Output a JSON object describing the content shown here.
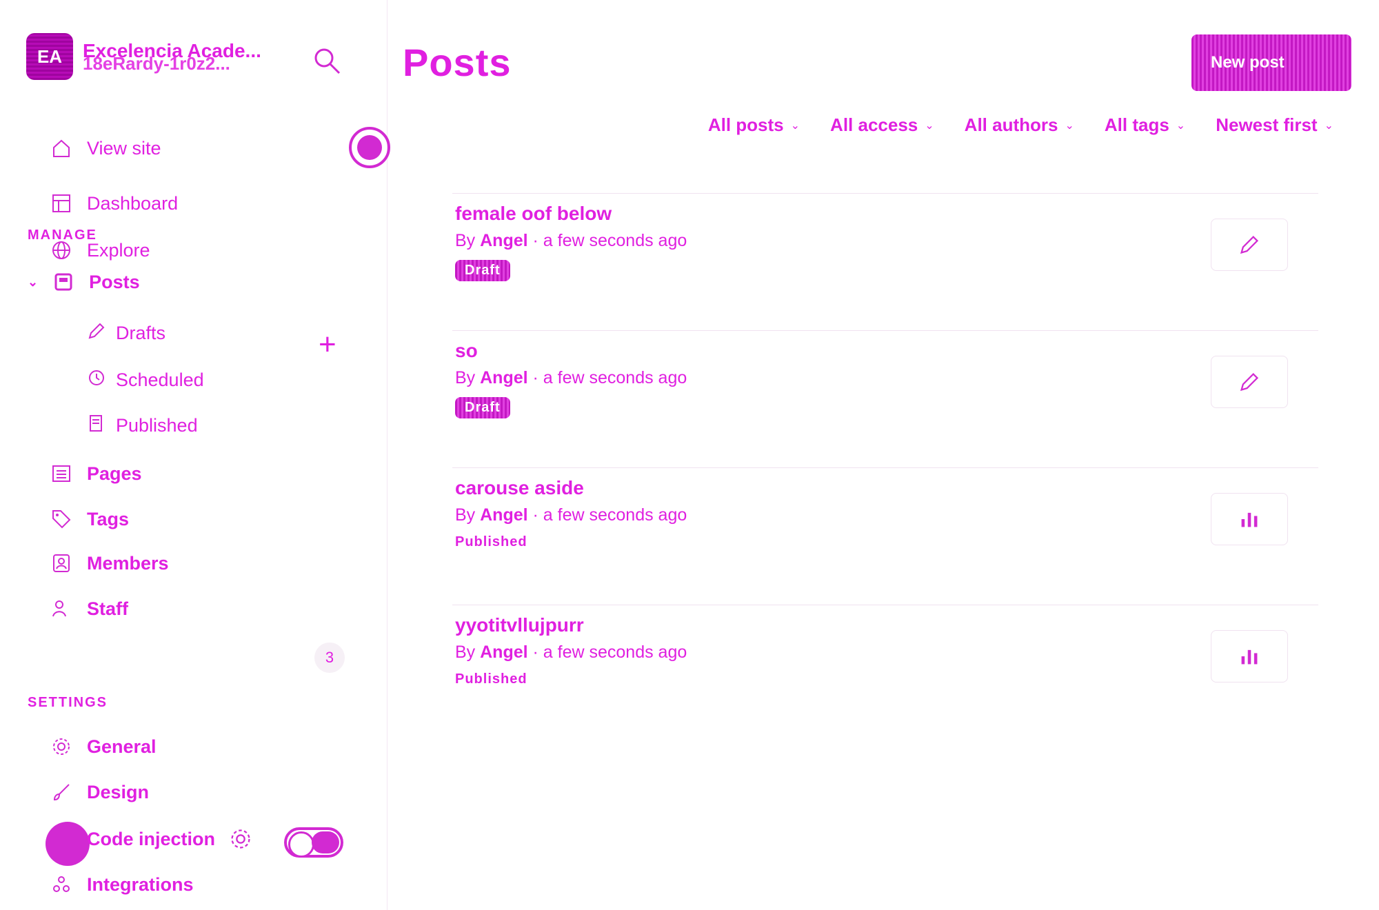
{
  "sidebar": {
    "brand_name": "Excelencia Acade...",
    "brand_sub": "18eRardy-1r0z2...",
    "brand_initials": "EA",
    "nav": [
      {
        "label": "View site",
        "icon": "home-icon"
      },
      {
        "label": "Dashboard",
        "icon": "layout-icon"
      },
      {
        "label": "Explore",
        "icon": "globe-icon"
      }
    ],
    "manage_label": "MANAGE",
    "posts_label": "Posts",
    "posts_sub": [
      {
        "label": "Drafts",
        "icon": "pencil-icon"
      },
      {
        "label": "Scheduled",
        "icon": "clock-icon"
      },
      {
        "label": "Published",
        "icon": "document-icon"
      }
    ],
    "pages_label": "Pages",
    "tags_label": "Tags",
    "members_label": "Members",
    "members_count": "3",
    "staff_label": "Staff",
    "settings_label": "SETTINGS",
    "settings": [
      {
        "label": "General",
        "icon": "gear-icon"
      },
      {
        "label": "Design",
        "icon": "brush-icon"
      },
      {
        "label": "Code injection",
        "icon": "code-icon"
      },
      {
        "label": "Integrations",
        "icon": "integrations-icon"
      }
    ]
  },
  "main": {
    "title": "Posts",
    "new_button": "New post",
    "filters": [
      "All posts",
      "All access",
      "All authors",
      "All tags",
      "Newest first"
    ]
  },
  "posts": [
    {
      "title": "female oof below",
      "author": "Angel",
      "time": "a few seconds ago",
      "status": "Draft",
      "action": "edit"
    },
    {
      "title": "so",
      "author": "Angel",
      "time": "a few seconds ago",
      "status": "Draft",
      "action": "edit"
    },
    {
      "title": "carouse aside",
      "author": "Angel",
      "time": "a few seconds ago",
      "status": "Published",
      "action": "analytics"
    },
    {
      "title": "yyotitvllujpurr",
      "author": "Angel",
      "time": "a few seconds ago",
      "status": "Published",
      "action": "analytics"
    }
  ],
  "colors": {
    "accent": "#e020e0",
    "border": "#f0e2f0"
  }
}
